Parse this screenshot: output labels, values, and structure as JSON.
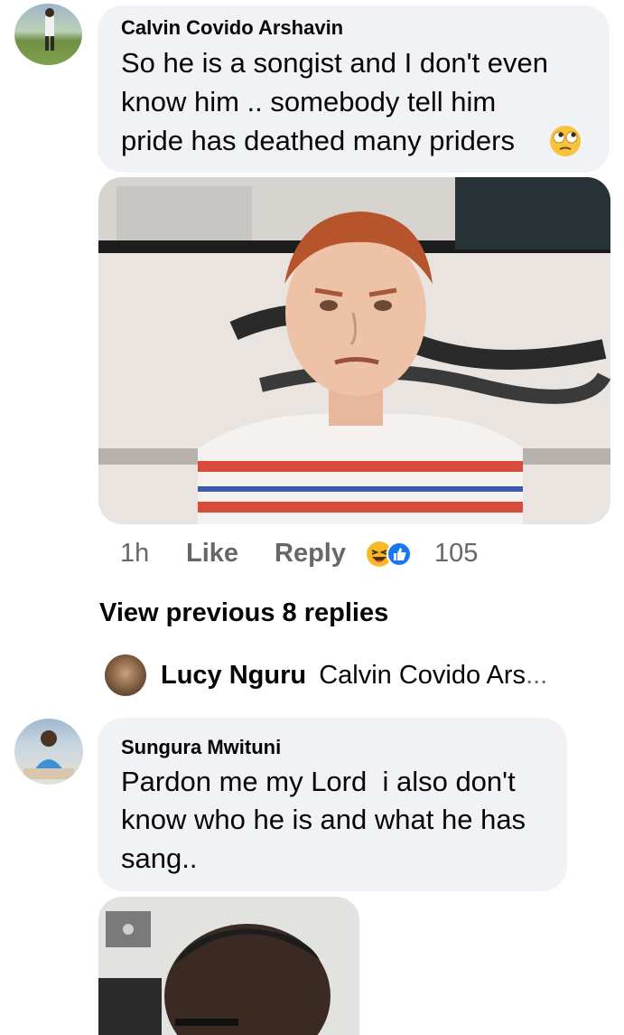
{
  "comment1": {
    "author": "Calvin Covido Arshavin",
    "lines": [
      "So he is a songist and I don't even",
      "know him .. somebody tell him",
      "pride has deathed many priders"
    ],
    "emoji": "face-with-rolling-eyes",
    "time": "1h",
    "like_label": "Like",
    "reply_label": "Reply",
    "reaction_icons": [
      "haha-reaction-icon",
      "like-reaction-icon"
    ],
    "reaction_count": "105"
  },
  "replies": {
    "view_previous_label": "View previous 8 replies",
    "preview_author": "Lucy Nguru",
    "preview_text": "Calvin Covido Ars",
    "preview_ellipsis": "..."
  },
  "comment2": {
    "author": "Sungura Mwituni",
    "lines": [
      "Pardon me my Lord  i also don't",
      "know who he is and what he has",
      "sang.."
    ]
  },
  "colors": {
    "bubble_bg": "#f0f2f5",
    "secondary_text": "#65676b",
    "like_blue": "#1877f2",
    "haha_yellow": "#f7b928"
  }
}
